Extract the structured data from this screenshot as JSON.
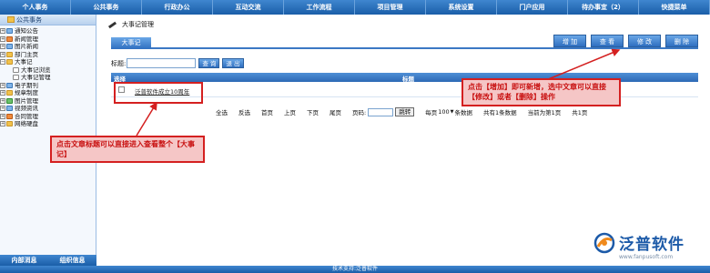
{
  "nav": [
    "个人事务",
    "公共事务",
    "行政办公",
    "互动交流",
    "工作流程",
    "项目管理",
    "系统设置",
    "门户应用",
    "待办事宜（2）",
    "快捷菜单"
  ],
  "sidebar": {
    "title": "公共事务",
    "items": [
      {
        "label": "通知公告",
        "level": 0
      },
      {
        "label": "新闻管理",
        "level": 0
      },
      {
        "label": "图片新闻",
        "level": 0
      },
      {
        "label": "部门主页",
        "level": 0
      },
      {
        "label": "大事记",
        "level": 0
      },
      {
        "label": "大事记浏览",
        "level": 1
      },
      {
        "label": "大事记管理",
        "level": 1
      },
      {
        "label": "电子期刊",
        "level": 0
      },
      {
        "label": "规章制度",
        "level": 0
      },
      {
        "label": "图片管理",
        "level": 0
      },
      {
        "label": "视频资讯",
        "level": 0
      },
      {
        "label": "合同管理",
        "level": 0
      },
      {
        "label": "网络硬盘",
        "level": 0
      }
    ],
    "footer": [
      "内部消息",
      "组织信息"
    ]
  },
  "main": {
    "page_title": "大事记管理",
    "tab": "大事记",
    "actions": [
      "增 加",
      "查 看",
      "修 改",
      "删 除"
    ],
    "search": {
      "label": "标题:",
      "value": "",
      "query_btn": "查 询",
      "exit_btn": "退 出"
    },
    "grid": {
      "headers": [
        "选择",
        "标题"
      ],
      "rows": [
        {
          "title": "泛普软件成立10周年"
        }
      ]
    },
    "pager": {
      "select_all": "全选",
      "invert": "反选",
      "first": "首页",
      "prev": "上页",
      "next": "下页",
      "last": "尾页",
      "page_label": "页码:",
      "jump": "跳转",
      "per_page_prefix": "每页",
      "per_page": "100",
      "per_page_suffix": "条数据",
      "total": "共有1条数据",
      "current": "当前为第1页",
      "total_pages": "共1页"
    }
  },
  "callouts": {
    "actions": "点击【增加】即可新增，选中文章可以直接【修改】或者【删除】操作",
    "title": "点击文章标题可以直接进入查看整个【大事记】"
  },
  "logo": {
    "name": "泛普软件",
    "url": "www.fanpusoft.com"
  },
  "footer": "技术支持:泛普软件"
}
